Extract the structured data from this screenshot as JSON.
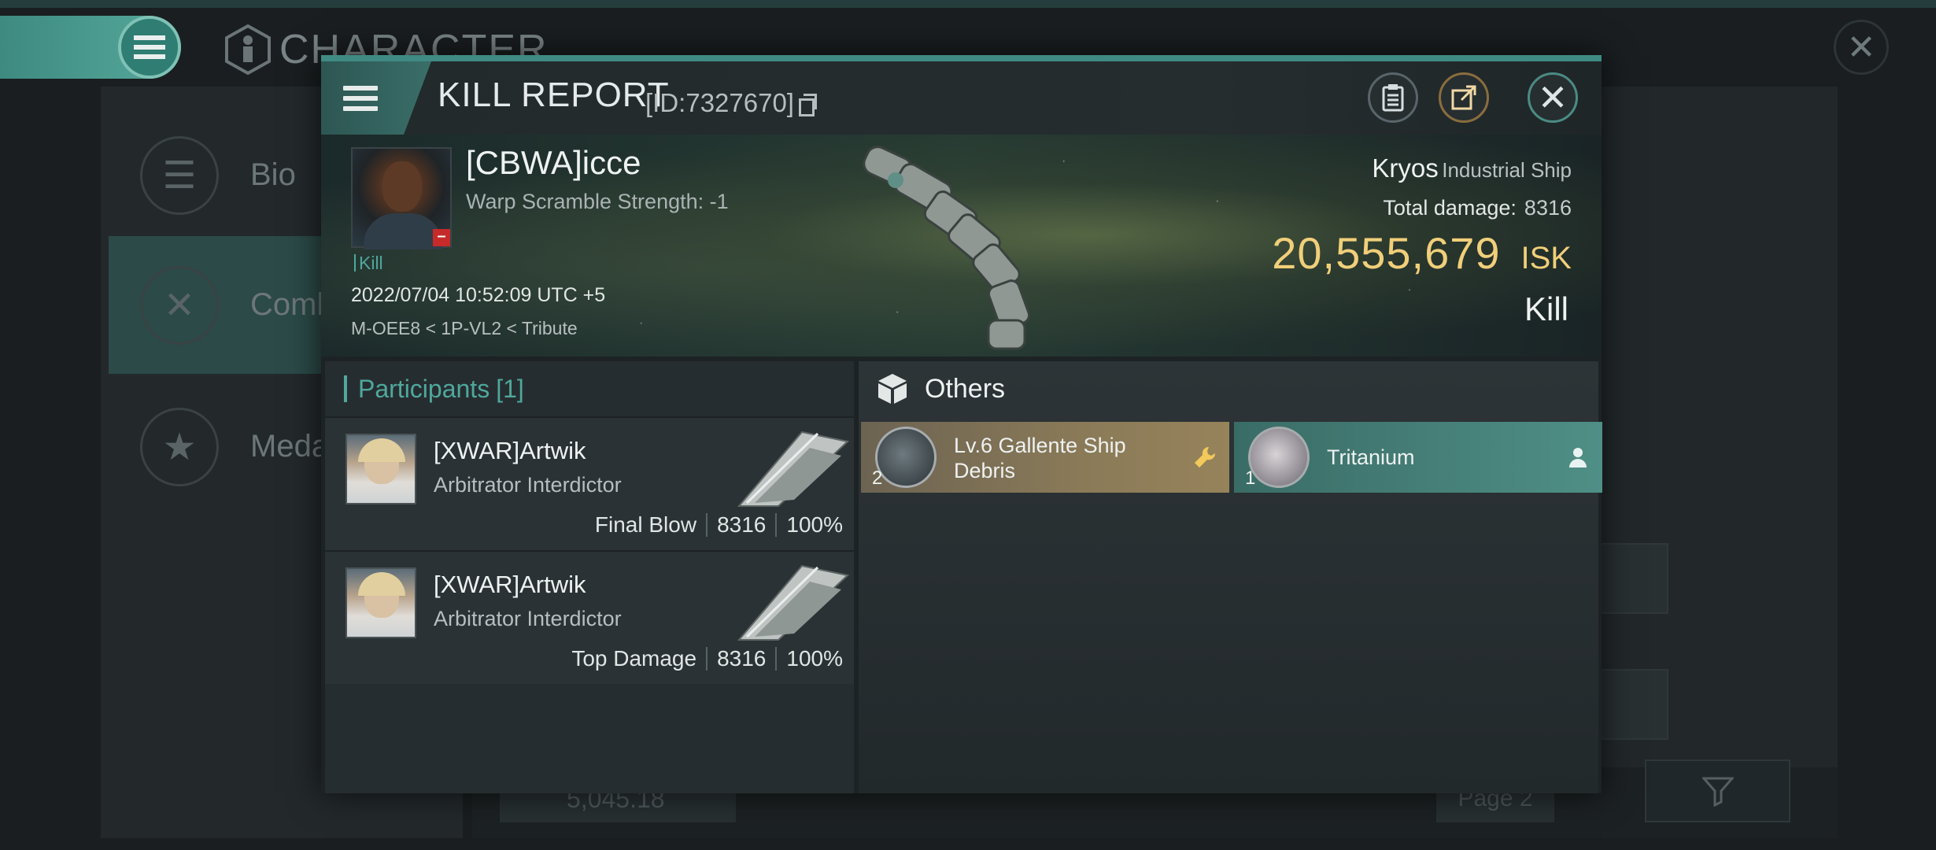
{
  "background": {
    "screen_title": "CHARACTER",
    "tabs": [
      {
        "label": "Bio",
        "icon": "list-icon"
      },
      {
        "label": "Comb",
        "icon": "crossed-swords-icon"
      },
      {
        "label": "Medal",
        "icon": "star-badge-icon"
      }
    ],
    "bottom_field": "5,045.18",
    "page_label": "Page 2"
  },
  "modal": {
    "title": "KILL REPORT",
    "report_id": "[ID:7327670]",
    "accent_color": "#3f8a82"
  },
  "victim": {
    "name": "[CBWA]icce",
    "warp_scramble": "Warp Scramble Strength: -1",
    "tag": "Kill",
    "timestamp": "2022/07/04 10:52:09 UTC +5",
    "location": "M-OEE8 < 1P-VL2 < Tribute",
    "ship_name": "Kryos",
    "ship_class": "Industrial Ship",
    "total_damage_label": "Total damage:",
    "total_damage": "8316",
    "isk_value": "20,555,679",
    "isk_unit": "ISK",
    "result": "Kill",
    "isk_color": "#f1cf7a"
  },
  "participants": {
    "header": "Participants",
    "count": "[1]",
    "rows": [
      {
        "name": "[XWAR]Artwik",
        "ship": "Arbitrator Interdictor",
        "role": "Final Blow",
        "damage": "8316",
        "percent": "100%"
      },
      {
        "name": "[XWAR]Artwik",
        "ship": "Arbitrator Interdictor",
        "role": "Top Damage",
        "damage": "8316",
        "percent": "100%"
      }
    ]
  },
  "others": {
    "header": "Others",
    "items": [
      {
        "qty": "2",
        "name": "Lv.6 Gallente Ship Debris",
        "tag_icon": "wrench-icon"
      },
      {
        "qty": "1",
        "name": "Tritanium",
        "tag_icon": "person-icon"
      }
    ]
  }
}
